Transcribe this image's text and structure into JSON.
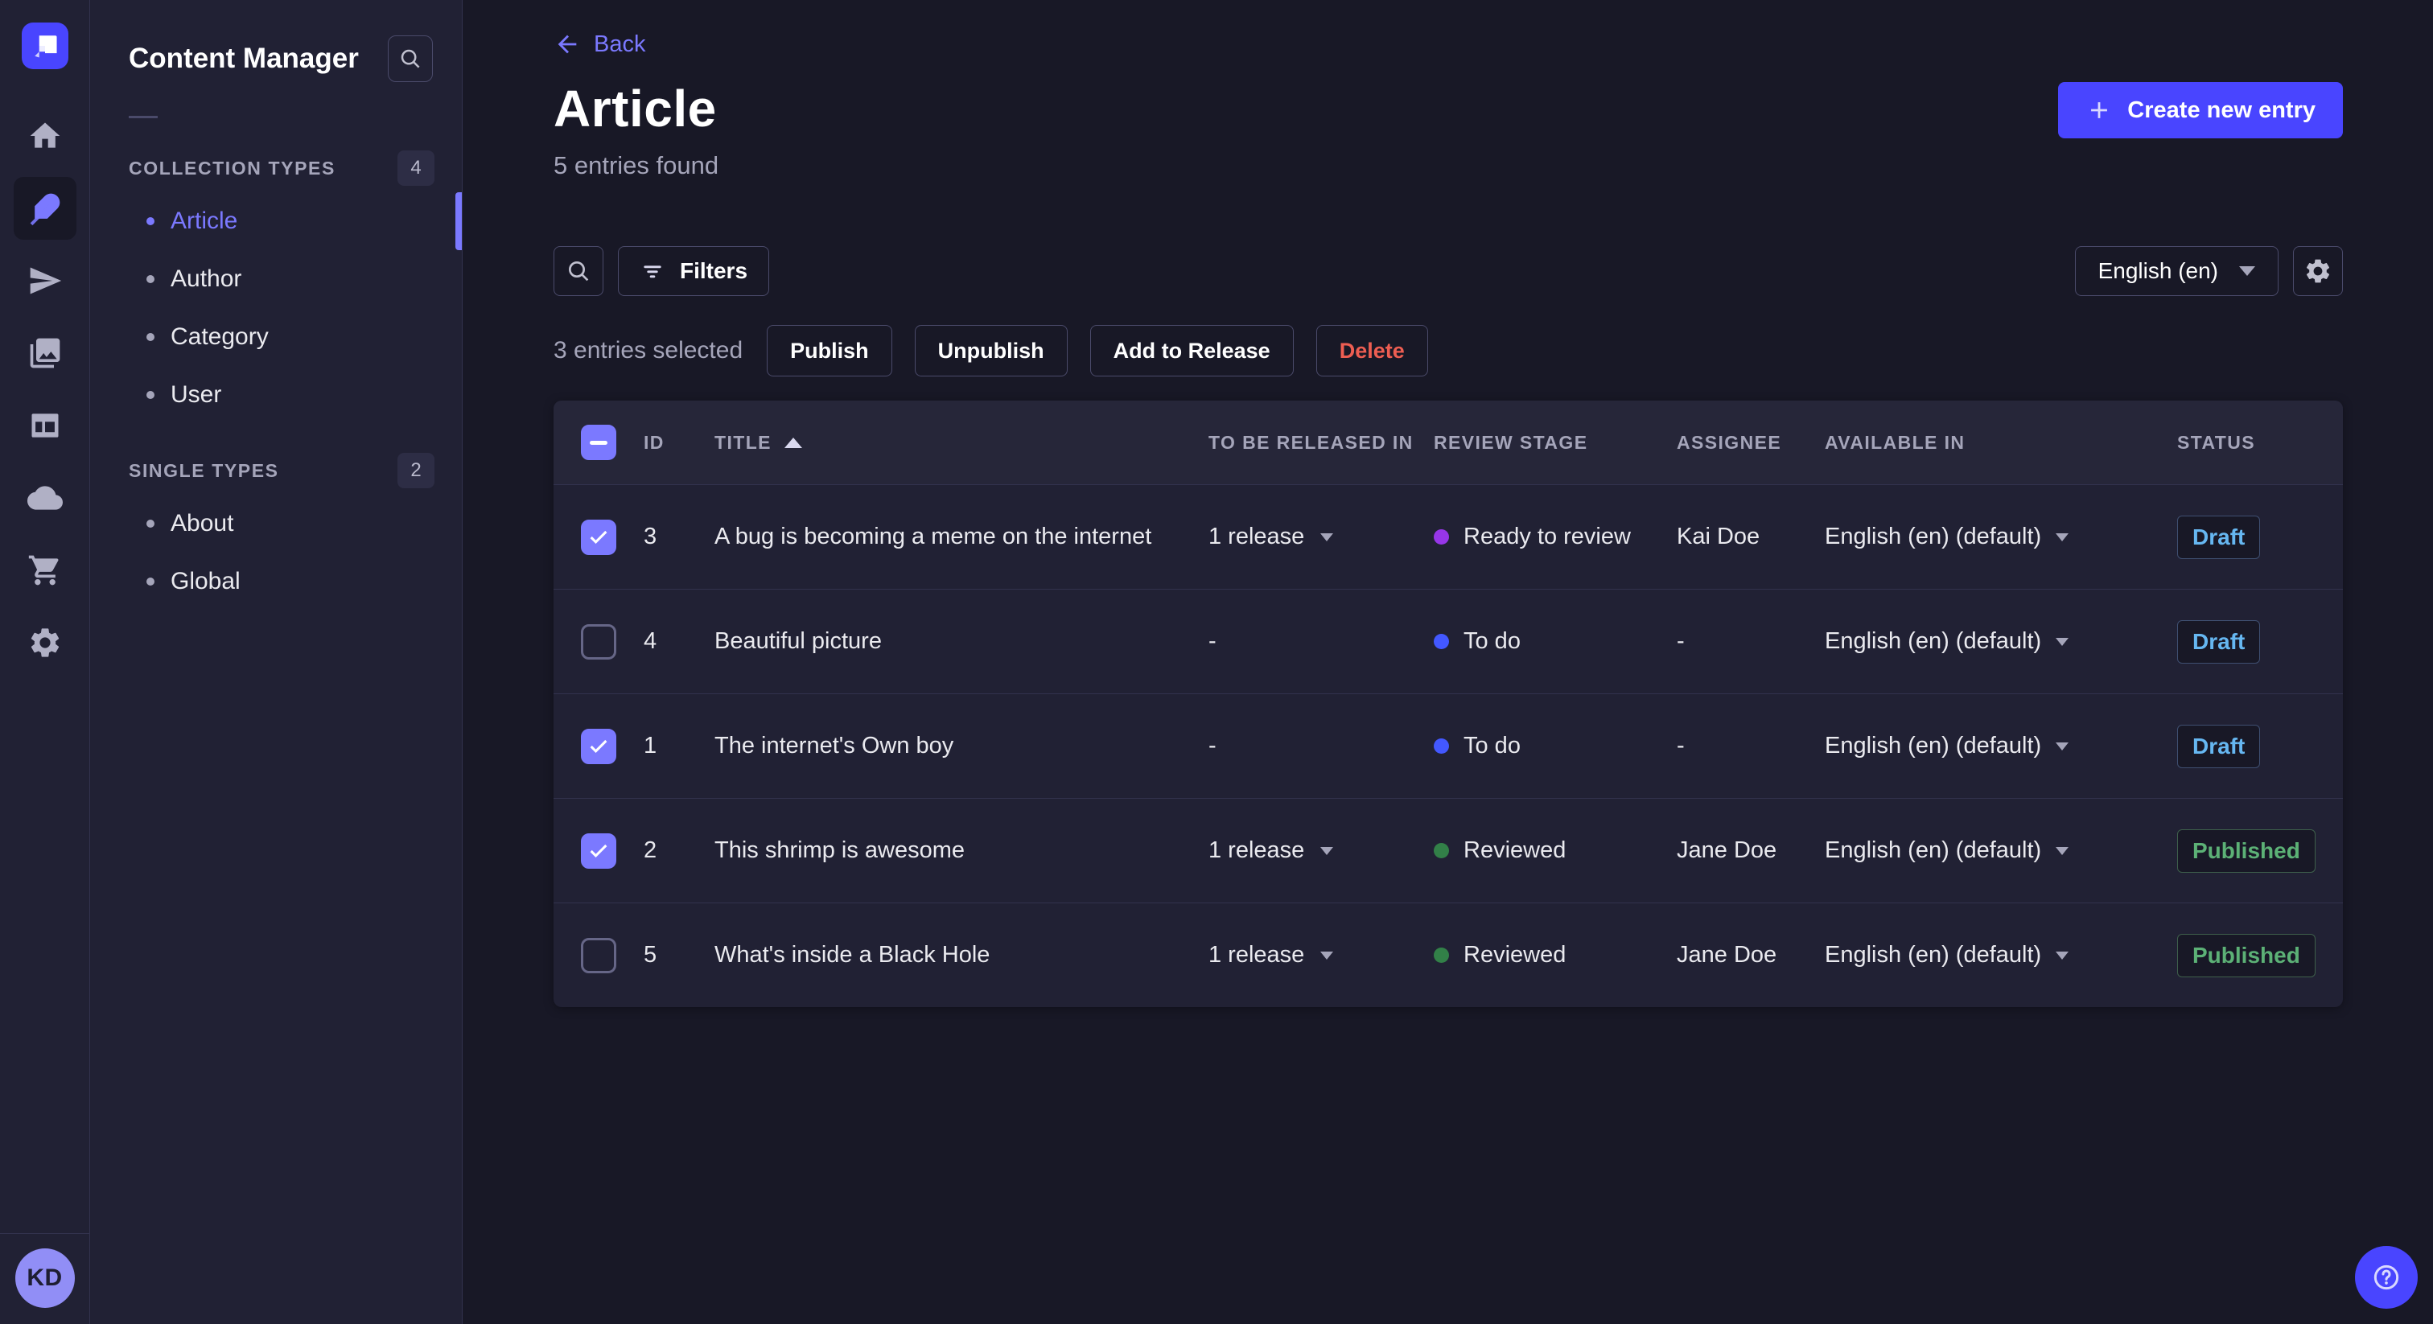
{
  "app": {
    "accent_color": "#4945ff",
    "active_color": "#7b79ff",
    "background": "#181826",
    "surface": "#212134"
  },
  "icon_sidebar": {
    "logo": "strapi-logo",
    "items": [
      {
        "icon": "home-icon",
        "active": false
      },
      {
        "icon": "content-manager-feather-icon",
        "active": true
      },
      {
        "icon": "releases-paper-plane-icon",
        "active": false
      },
      {
        "icon": "media-library-icon",
        "active": false
      },
      {
        "icon": "content-type-builder-icon",
        "active": false
      },
      {
        "icon": "cloud-icon",
        "active": false
      },
      {
        "icon": "marketplace-cart-icon",
        "active": false
      },
      {
        "icon": "settings-gear-icon",
        "active": false
      }
    ],
    "avatar_initials": "KD"
  },
  "subnav": {
    "title": "Content Manager",
    "sections": [
      {
        "label": "COLLECTION TYPES",
        "count": "4",
        "items": [
          {
            "label": "Article",
            "active": true
          },
          {
            "label": "Author",
            "active": false
          },
          {
            "label": "Category",
            "active": false
          },
          {
            "label": "User",
            "active": false
          }
        ]
      },
      {
        "label": "SINGLE TYPES",
        "count": "2",
        "items": [
          {
            "label": "About",
            "active": false
          },
          {
            "label": "Global",
            "active": false
          }
        ]
      }
    ]
  },
  "header": {
    "back_label": "Back",
    "title": "Article",
    "subtitle": "5 entries found",
    "create_button_label": "Create new entry"
  },
  "toolbar": {
    "filters_label": "Filters",
    "locale_value": "English (en)"
  },
  "selection": {
    "text": "3 entries selected",
    "header_indeterminate": true,
    "actions": [
      {
        "label": "Publish"
      },
      {
        "label": "Unpublish"
      },
      {
        "label": "Add to Release"
      },
      {
        "label": "Delete"
      }
    ]
  },
  "table": {
    "columns": [
      "ID",
      "TITLE",
      "TO BE RELEASED IN",
      "REVIEW STAGE",
      "ASSIGNEE",
      "AVAILABLE IN",
      "STATUS"
    ],
    "sort_column": "TITLE",
    "sort_direction": "asc",
    "rows": [
      {
        "checked": true,
        "id": "3",
        "title": "A bug is becoming a meme on the internet",
        "release": "1 release",
        "review_stage": "Ready to review",
        "review_stage_color": "#9736e8",
        "assignee": "Kai Doe",
        "available_in": "English (en) (default)",
        "status": "Draft"
      },
      {
        "checked": false,
        "id": "4",
        "title": "Beautiful picture",
        "release": "-",
        "review_stage": "To do",
        "review_stage_color": "#4358ff",
        "assignee": "-",
        "available_in": "English (en) (default)",
        "status": "Draft"
      },
      {
        "checked": true,
        "id": "1",
        "title": "The internet's Own boy",
        "release": "-",
        "review_stage": "To do",
        "review_stage_color": "#4358ff",
        "assignee": "-",
        "available_in": "English (en) (default)",
        "status": "Draft"
      },
      {
        "checked": true,
        "id": "2",
        "title": "This shrimp is awesome",
        "release": "1 release",
        "review_stage": "Reviewed",
        "review_stage_color": "#328048",
        "assignee": "Jane Doe",
        "available_in": "English (en) (default)",
        "status": "Published"
      },
      {
        "checked": false,
        "id": "5",
        "title": "What's inside a Black Hole",
        "release": "1 release",
        "review_stage": "Reviewed",
        "review_stage_color": "#328048",
        "assignee": "Jane Doe",
        "available_in": "English (en) (default)",
        "status": "Published"
      }
    ]
  },
  "footer": {
    "help_icon": "question-mark-icon"
  }
}
